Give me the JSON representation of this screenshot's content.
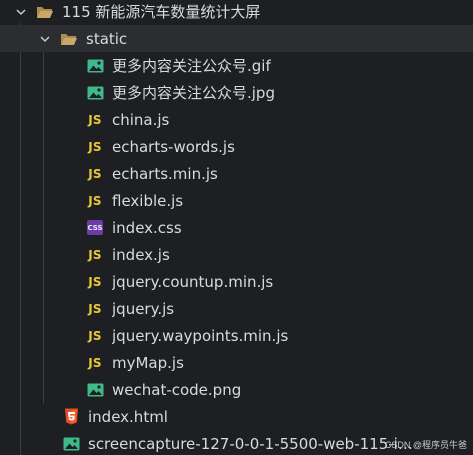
{
  "explorer": {
    "root_folder": "115 新能源汽车数量统计大屏",
    "static_folder": "static",
    "static_files": [
      {
        "name": "更多内容关注公众号.gif",
        "icon": "image-icon"
      },
      {
        "name": "更多内容关注公众号.jpg",
        "icon": "image-icon"
      },
      {
        "name": "china.js",
        "icon": "js-icon"
      },
      {
        "name": "echarts-words.js",
        "icon": "js-icon"
      },
      {
        "name": "echarts.min.js",
        "icon": "js-icon"
      },
      {
        "name": "flexible.js",
        "icon": "js-icon"
      },
      {
        "name": "index.css",
        "icon": "css-icon"
      },
      {
        "name": "index.js",
        "icon": "js-icon"
      },
      {
        "name": "jquery.countup.min.js",
        "icon": "js-icon"
      },
      {
        "name": "jquery.js",
        "icon": "js-icon"
      },
      {
        "name": "jquery.waypoints.min.js",
        "icon": "js-icon"
      },
      {
        "name": "myMap.js",
        "icon": "js-icon"
      },
      {
        "name": "wechat-code.png",
        "icon": "image-icon"
      }
    ],
    "root_files": [
      {
        "name": "index.html",
        "icon": "html-icon"
      },
      {
        "name": "screencapture-127-0-0-1-5500-web-115-index-...",
        "icon": "image-icon"
      }
    ],
    "js_badge": "JS",
    "css_badge": "CSS"
  },
  "watermark": "CSDN @程序员牛爸",
  "colors": {
    "background": "#1e1f22",
    "selected_row": "#2b2d30",
    "js_yellow": "#e8c83a",
    "css_purple": "#6a3da5",
    "html_orange": "#e44d26",
    "image_teal": "#3fb98a",
    "folder": "#c8a96a"
  }
}
